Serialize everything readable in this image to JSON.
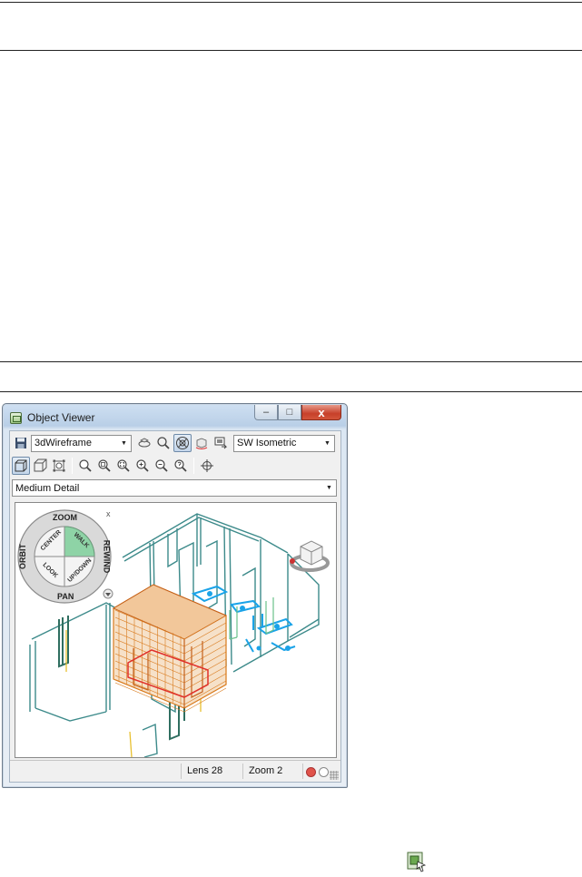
{
  "window": {
    "title": "Object Viewer",
    "minimize_glyph": "–",
    "maximize_glyph": "□",
    "close_glyph": "x"
  },
  "toolbar": {
    "visual_style": "3dWireframe",
    "view": "SW Isometric",
    "detail": "Medium Detail"
  },
  "wheel": {
    "zoom": "ZOOM",
    "orbit": "ORBIT",
    "center": "CENTER",
    "walk": "WALK",
    "rewind": "REWIND",
    "look": "LOOK",
    "updown": "UP/DOWN",
    "pan": "PAN",
    "close_glyph": "x"
  },
  "status": {
    "lens": "Lens 28",
    "zoom": "Zoom 2"
  },
  "colors": {
    "accent_orange": "#d97a1c",
    "teal_lines": "#3c8a8a",
    "blue_fixtures": "#1aa3e8",
    "red_outline": "#e0302a",
    "yellow_lines": "#e8c030"
  }
}
